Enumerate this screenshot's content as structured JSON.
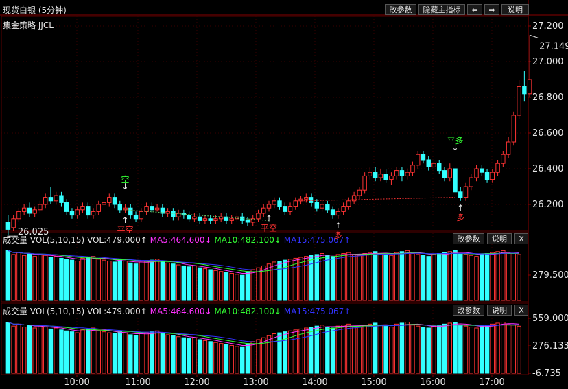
{
  "window_title": "现货白银 (5分钟)",
  "strategy_label": "集金策略 JJCL",
  "toolbar": {
    "change_params": "改参数",
    "hide_main_indicator": "隐藏主指标",
    "left_arrow": "⬅",
    "right_arrow": "➡",
    "help": "说明",
    "close": "X"
  },
  "icons": {
    "left": "arrow-left-icon",
    "right": "arrow-right-icon"
  },
  "colors": {
    "up": "#ff3333",
    "down": "#33ffff",
    "ma5": "#ff33ff",
    "ma10": "#33ff33",
    "ma15": "#3333ff",
    "signal_short": "#33ff33",
    "signal_long": "#ff3333",
    "grid": "#3a0000"
  },
  "price_panel": {
    "y_ticks": [
      "27.200",
      "27.000",
      "26.800",
      "26.600",
      "26.400",
      "26.200"
    ],
    "high_marker": "27.149",
    "low_marker": "26.025",
    "signals": [
      {
        "text": "空",
        "kind": "short",
        "arrow": "↓"
      },
      {
        "text": "平空",
        "kind": "close_short",
        "arrow": "↑"
      },
      {
        "text": "平空",
        "kind": "close_short",
        "arrow": "↑"
      },
      {
        "text": "多",
        "kind": "long",
        "arrow": "↑"
      },
      {
        "text": "平多",
        "kind": "close_long",
        "arrow": "↓"
      },
      {
        "text": "多",
        "kind": "long",
        "arrow": "↑"
      }
    ]
  },
  "vol_panel_1": {
    "name": "成交量",
    "formula": "VOL(5,10,15)",
    "vol": "VOL:479.000↑",
    "ma5": "MA5:464.600↓",
    "ma10": "MA10:482.100↓",
    "ma15": "MA15:475.067↑",
    "y_ticks": [
      "279.500"
    ]
  },
  "vol_panel_2": {
    "name": "成交量",
    "formula": "VOL(5,10,15)",
    "vol": "VOL:479.000↑",
    "ma5": "MA5:464.600↓",
    "ma10": "MA10:482.100↓",
    "ma15": "MA15:475.067↑",
    "y_ticks": [
      "559.000",
      "276.133",
      "-6.735"
    ]
  },
  "x_ticks": [
    "10:00",
    "11:00",
    "12:00",
    "13:00",
    "14:00",
    "15:00",
    "16:00",
    "17:00"
  ],
  "chart_data": {
    "type": "candlestick",
    "y_range": [
      26.0,
      27.2
    ],
    "candles": [
      [
        26.1,
        26.06,
        26.14,
        26.03
      ],
      [
        26.07,
        26.12,
        26.14,
        26.05
      ],
      [
        26.12,
        26.16,
        26.18,
        26.1
      ],
      [
        26.16,
        26.18,
        26.2,
        26.14
      ],
      [
        26.18,
        26.15,
        26.21,
        26.13
      ],
      [
        26.15,
        26.17,
        26.19,
        26.13
      ],
      [
        26.17,
        26.2,
        26.22,
        26.15
      ],
      [
        26.2,
        26.24,
        26.26,
        26.18
      ],
      [
        26.24,
        26.22,
        26.3,
        26.2
      ],
      [
        26.22,
        26.25,
        26.27,
        26.2
      ],
      [
        26.25,
        26.21,
        26.27,
        26.19
      ],
      [
        26.21,
        26.16,
        26.23,
        26.14
      ],
      [
        26.16,
        26.14,
        26.18,
        26.12
      ],
      [
        26.14,
        26.17,
        26.19,
        26.12
      ],
      [
        26.17,
        26.19,
        26.21,
        26.15
      ],
      [
        26.19,
        26.14,
        26.21,
        26.12
      ],
      [
        26.14,
        26.16,
        26.18,
        26.12
      ],
      [
        26.16,
        26.2,
        26.22,
        26.14
      ],
      [
        26.2,
        26.21,
        26.23,
        26.18
      ],
      [
        26.21,
        26.24,
        26.26,
        26.19
      ],
      [
        26.24,
        26.2,
        26.26,
        26.18
      ],
      [
        26.2,
        26.17,
        26.22,
        26.15
      ],
      [
        26.17,
        26.18,
        26.2,
        26.15
      ],
      [
        26.18,
        26.14,
        26.2,
        26.12
      ],
      [
        26.14,
        26.12,
        26.16,
        26.1
      ],
      [
        26.12,
        26.16,
        26.18,
        26.1
      ],
      [
        26.16,
        26.19,
        26.21,
        26.14
      ],
      [
        26.19,
        26.17,
        26.21,
        26.15
      ],
      [
        26.17,
        26.18,
        26.2,
        26.16
      ],
      [
        26.18,
        26.15,
        26.2,
        26.13
      ],
      [
        26.15,
        26.16,
        26.18,
        26.13
      ],
      [
        26.16,
        26.13,
        26.18,
        26.11
      ],
      [
        26.13,
        26.15,
        26.17,
        26.11
      ],
      [
        26.15,
        26.14,
        26.17,
        26.12
      ],
      [
        26.14,
        26.12,
        26.16,
        26.1
      ],
      [
        26.12,
        26.13,
        26.15,
        26.1
      ],
      [
        26.13,
        26.11,
        26.15,
        26.09
      ],
      [
        26.11,
        26.12,
        26.14,
        26.09
      ],
      [
        26.12,
        26.11,
        26.14,
        26.09
      ],
      [
        26.11,
        26.12,
        26.14,
        26.09
      ],
      [
        26.12,
        26.13,
        26.15,
        26.1
      ],
      [
        26.13,
        26.11,
        26.15,
        26.09
      ],
      [
        26.11,
        26.12,
        26.14,
        26.09
      ],
      [
        26.12,
        26.13,
        26.15,
        26.1
      ],
      [
        26.13,
        26.11,
        26.15,
        26.09
      ],
      [
        26.11,
        26.1,
        26.13,
        26.08
      ],
      [
        26.1,
        26.12,
        26.14,
        26.08
      ],
      [
        26.12,
        26.15,
        26.17,
        26.1
      ],
      [
        26.15,
        26.18,
        26.2,
        26.13
      ],
      [
        26.18,
        26.2,
        26.22,
        26.16
      ],
      [
        26.2,
        26.22,
        26.24,
        26.18
      ],
      [
        26.22,
        26.19,
        26.24,
        26.17
      ],
      [
        26.19,
        26.16,
        26.21,
        26.14
      ],
      [
        26.16,
        26.19,
        26.21,
        26.14
      ],
      [
        26.19,
        26.22,
        26.24,
        26.17
      ],
      [
        26.22,
        26.23,
        26.25,
        26.2
      ],
      [
        26.23,
        26.24,
        26.26,
        26.21
      ],
      [
        26.24,
        26.21,
        26.26,
        26.19
      ],
      [
        26.21,
        26.18,
        26.23,
        26.16
      ],
      [
        26.18,
        26.2,
        26.22,
        26.16
      ],
      [
        26.2,
        26.17,
        26.22,
        26.15
      ],
      [
        26.17,
        26.14,
        26.19,
        26.12
      ],
      [
        26.14,
        26.16,
        26.18,
        26.12
      ],
      [
        26.16,
        26.19,
        26.21,
        26.14
      ],
      [
        26.19,
        26.22,
        26.24,
        26.17
      ],
      [
        26.22,
        26.25,
        26.27,
        26.2
      ],
      [
        26.25,
        26.28,
        26.3,
        26.23
      ],
      [
        26.28,
        26.36,
        26.38,
        26.26
      ],
      [
        26.36,
        26.38,
        26.41,
        26.34
      ],
      [
        26.38,
        26.35,
        26.41,
        26.33
      ],
      [
        26.35,
        26.37,
        26.4,
        26.33
      ],
      [
        26.37,
        26.34,
        26.4,
        26.32
      ],
      [
        26.34,
        26.36,
        26.38,
        26.31
      ],
      [
        26.36,
        26.39,
        26.41,
        26.34
      ],
      [
        26.39,
        26.36,
        26.41,
        26.33
      ],
      [
        26.36,
        26.38,
        26.4,
        26.34
      ],
      [
        26.38,
        26.42,
        26.44,
        26.36
      ],
      [
        26.42,
        26.48,
        26.5,
        26.4
      ],
      [
        26.48,
        26.45,
        26.5,
        26.43
      ],
      [
        26.45,
        26.41,
        26.47,
        26.39
      ],
      [
        26.41,
        26.43,
        26.45,
        26.39
      ],
      [
        26.43,
        26.39,
        26.45,
        26.37
      ],
      [
        26.39,
        26.35,
        26.41,
        26.33
      ],
      [
        26.35,
        26.4,
        26.43,
        26.33
      ],
      [
        26.4,
        26.27,
        26.42,
        26.25
      ],
      [
        26.27,
        26.24,
        26.3,
        26.22
      ],
      [
        26.24,
        26.3,
        26.32,
        26.22
      ],
      [
        26.3,
        26.35,
        26.37,
        26.28
      ],
      [
        26.35,
        26.4,
        26.42,
        26.33
      ],
      [
        26.4,
        26.38,
        26.42,
        26.36
      ],
      [
        26.38,
        26.34,
        26.4,
        26.32
      ],
      [
        26.34,
        26.38,
        26.4,
        26.32
      ],
      [
        26.38,
        26.43,
        26.45,
        26.36
      ],
      [
        26.43,
        26.48,
        26.5,
        26.41
      ],
      [
        26.48,
        26.55,
        26.58,
        26.46
      ],
      [
        26.55,
        26.7,
        26.72,
        26.53
      ],
      [
        26.7,
        26.86,
        26.9,
        26.68
      ],
      [
        26.86,
        26.82,
        26.95,
        26.78
      ],
      [
        26.82,
        26.9,
        27.149,
        26.8
      ]
    ],
    "volume_range": [
      -6.735,
      559.0
    ],
    "volumes": [
      520,
      480,
      500,
      470,
      490,
      460,
      480,
      470,
      450,
      460,
      440,
      430,
      420,
      410,
      440,
      450,
      460,
      430,
      420,
      410,
      400,
      420,
      410,
      390,
      380,
      400,
      410,
      420,
      430,
      400,
      390,
      380,
      370,
      360,
      350,
      360,
      340,
      330,
      320,
      310,
      300,
      290,
      280,
      270,
      260,
      300,
      320,
      340,
      360,
      380,
      400,
      410,
      420,
      430,
      440,
      450,
      460,
      470,
      480,
      490,
      470,
      460,
      480,
      490,
      500,
      480,
      470,
      490,
      500,
      510,
      490,
      480,
      470,
      500,
      510,
      520,
      490,
      480,
      470,
      460,
      480,
      490,
      500,
      510,
      520,
      490,
      480,
      470,
      460,
      480,
      490,
      500,
      510,
      520,
      500,
      490,
      479
    ]
  }
}
